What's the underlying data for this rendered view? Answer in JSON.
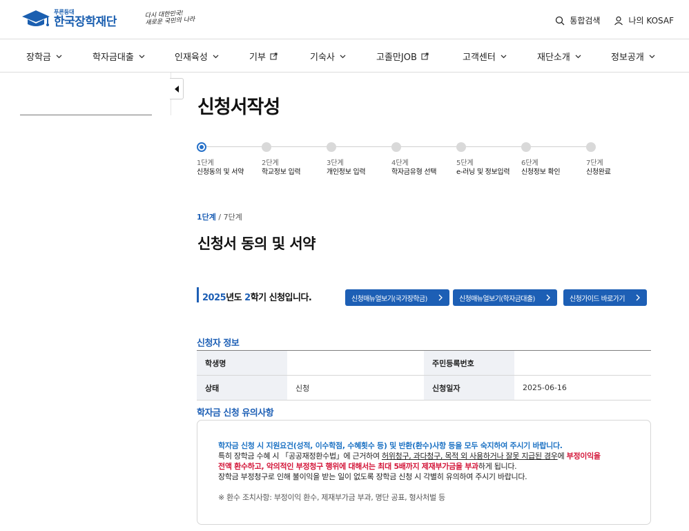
{
  "header": {
    "logo_small": "푸른등대",
    "logo_main": "한국장학재단",
    "slogan_line1": "다시 대한민국!",
    "slogan_line2": "새로운 국민의 나라",
    "search_label": "통합검색",
    "my_label": "나의 KOSAF"
  },
  "nav": {
    "items": [
      "장학금",
      "학자금대출",
      "인재육성",
      "기부",
      "기숙사",
      "고졸만JOB",
      "고객센터",
      "재단소개",
      "정보공개"
    ]
  },
  "page": {
    "title": "신청서작성",
    "progress_current": "1단계",
    "progress_total": " / 7단계",
    "subtitle": "신청서 동의 및 서약"
  },
  "steps": [
    {
      "num": "1단계",
      "name": "신청동의 및 서약"
    },
    {
      "num": "2단계",
      "name": "학교정보 입력"
    },
    {
      "num": "3단계",
      "name": "개인정보 입력"
    },
    {
      "num": "4단계",
      "name": "학자금유형 선택"
    },
    {
      "num": "5단계",
      "name": "e-러닝 및 정보입력"
    },
    {
      "num": "6단계",
      "name": "신청정보 확인"
    },
    {
      "num": "7단계",
      "name": "신청완료"
    }
  ],
  "term": {
    "year": "2025",
    "year_suffix": "년도 ",
    "semester": "2",
    "semester_suffix": "학기 신청입니다."
  },
  "buttons": {
    "manual_national": "신청매뉴얼보기(국가장학금)",
    "manual_loan": "신청매뉴얼보기(학자금대출)",
    "guide": "신청가이드 바로가기"
  },
  "applicant": {
    "section_title": "신청자 정보",
    "student_name_label": "학생명",
    "student_name_value": "",
    "rrn_label": "주민등록번호",
    "rrn_value": "",
    "status_label": "상태",
    "status_value": "신청",
    "date_label": "신청일자",
    "date_value": "2025-06-16"
  },
  "notice": {
    "section_title": "학자금 신청 유의사항",
    "line1": "학자금 신청 시 지원요건(성적, 이수학점, 수혜횟수 등) 및 반환(환수)사항 등을 모두 숙지하여 주시기 바랍니다.",
    "line2_a": "특히 장학금 수혜 시 「공공재정환수법」에 근거하여 ",
    "line2_b": "허위청구, 과다청구, 목적 외 사용하거나 잘못 지급된 경우",
    "line2_c": "에 ",
    "line2_d": "부정이익을",
    "line3_a": "전액 환수하고, 악의적인 부정청구 행위에 대해서는 최대 5배까지 제재부가금을 부과",
    "line3_b": "하게 됩니다.",
    "line4": "장학금 부정청구로 인해 불이익을 받는 일이 없도록 장학금 신청 시 각별히 유의하여 주시기 바랍니다.",
    "footnote": "※ 환수 조치사항: 부정이익 환수, 제재부가금 부과, 명단 공표, 형사처벌 등"
  }
}
